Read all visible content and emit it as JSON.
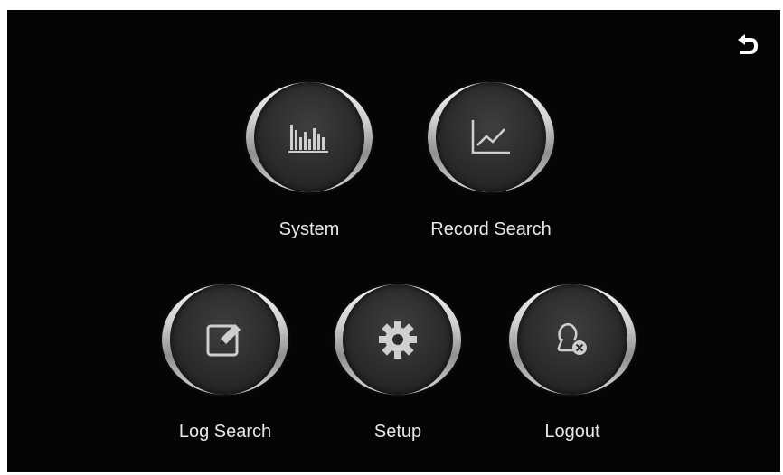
{
  "header": {
    "back_icon": "back-arrow-icon"
  },
  "menu": {
    "system": {
      "label": "System",
      "icon": "bar-chart-icon"
    },
    "record_search": {
      "label": "Record Search",
      "icon": "line-chart-icon"
    },
    "log_search": {
      "label": "Log Search",
      "icon": "edit-icon"
    },
    "setup": {
      "label": "Setup",
      "icon": "gear-icon"
    },
    "logout": {
      "label": "Logout",
      "icon": "user-remove-icon"
    }
  },
  "colors": {
    "background": "#050505",
    "label": "#e8e8e8",
    "icon": "#cfcfcf"
  }
}
